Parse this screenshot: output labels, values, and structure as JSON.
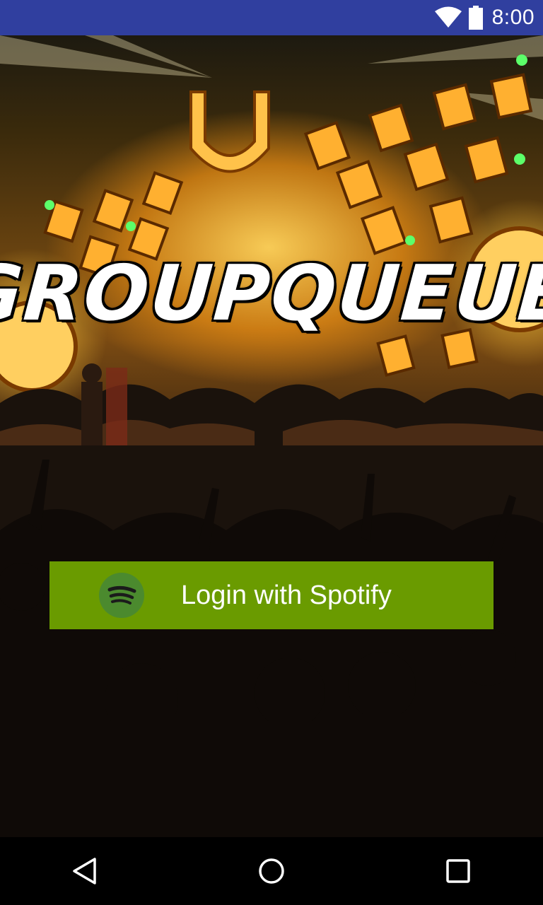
{
  "status_bar": {
    "time": "8:00",
    "icons": [
      "wifi-icon",
      "battery-icon"
    ]
  },
  "logo": {
    "text": "GROUPQUEUE"
  },
  "login_button": {
    "label": "Login with Spotify",
    "icon": "spotify-icon",
    "color": "#6a9b00"
  },
  "navigation_bar": {
    "buttons": [
      "back-icon",
      "home-icon",
      "recents-icon"
    ]
  },
  "colors": {
    "status_bar": "#303f9f",
    "nav_bar": "#000000"
  }
}
